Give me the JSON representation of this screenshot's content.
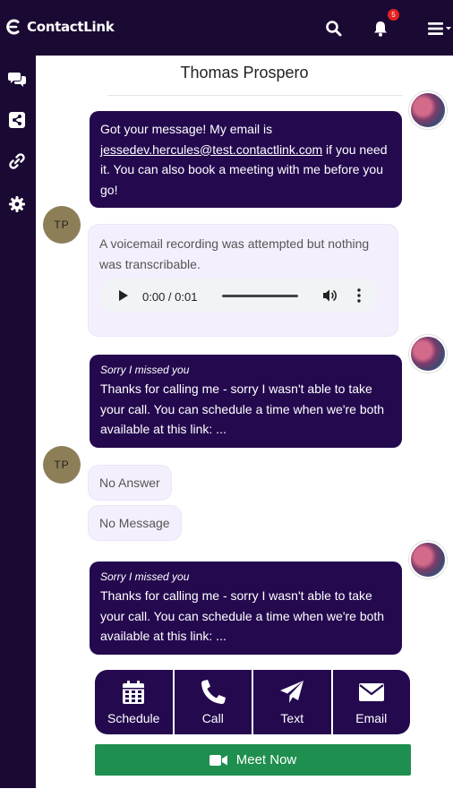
{
  "app": {
    "brand_name": "ContactLink",
    "notification_count": "5"
  },
  "conversation": {
    "contact_name": "Thomas Prospero",
    "contact_initials": "TP",
    "messages": [
      {
        "direction": "outgoing",
        "text_before_link": "Got your message! My email is ",
        "link_text": "jessedev.hercules@test.contactlink.com",
        "text_after_link": " if you need it. You can also book a meeting with me before you go!"
      },
      {
        "direction": "incoming",
        "text": "A voicemail recording was attempted but nothing was transcribable.",
        "audio_time": "0:00 / 0:01"
      },
      {
        "direction": "outgoing",
        "subject": "Sorry I missed you",
        "text": "Thanks for calling me - sorry I wasn't able to take your call. You can schedule a time when we're both available at this link: ..."
      },
      {
        "direction": "incoming",
        "text": "No Answer"
      },
      {
        "direction": "incoming",
        "text": "No Message"
      },
      {
        "direction": "outgoing",
        "subject": "Sorry I missed you",
        "text": "Thanks for calling me - sorry I wasn't able to take your call. You can schedule a time when we're both available at this link: ..."
      }
    ]
  },
  "actions": [
    {
      "label": "Schedule",
      "icon": "calendar-icon"
    },
    {
      "label": "Call",
      "icon": "phone-icon"
    },
    {
      "label": "Text",
      "icon": "paper-plane-icon"
    },
    {
      "label": "Email",
      "icon": "envelope-icon"
    }
  ],
  "meet_now": {
    "label": "Meet Now",
    "icon": "video-camera-icon"
  },
  "sidebar": {
    "items": [
      {
        "icon": "chat-bubbles-icon"
      },
      {
        "icon": "share-icon"
      },
      {
        "icon": "link-icon"
      },
      {
        "icon": "gear-icon"
      }
    ]
  },
  "colors": {
    "nav_background": "#1a0a33",
    "outgoing_bubble": "#24094f",
    "incoming_bubble": "#f4effc",
    "meet_now_green": "#1e8f4e",
    "badge_red": "#e52020",
    "avatar_initials_bg": "#8c7f58"
  }
}
